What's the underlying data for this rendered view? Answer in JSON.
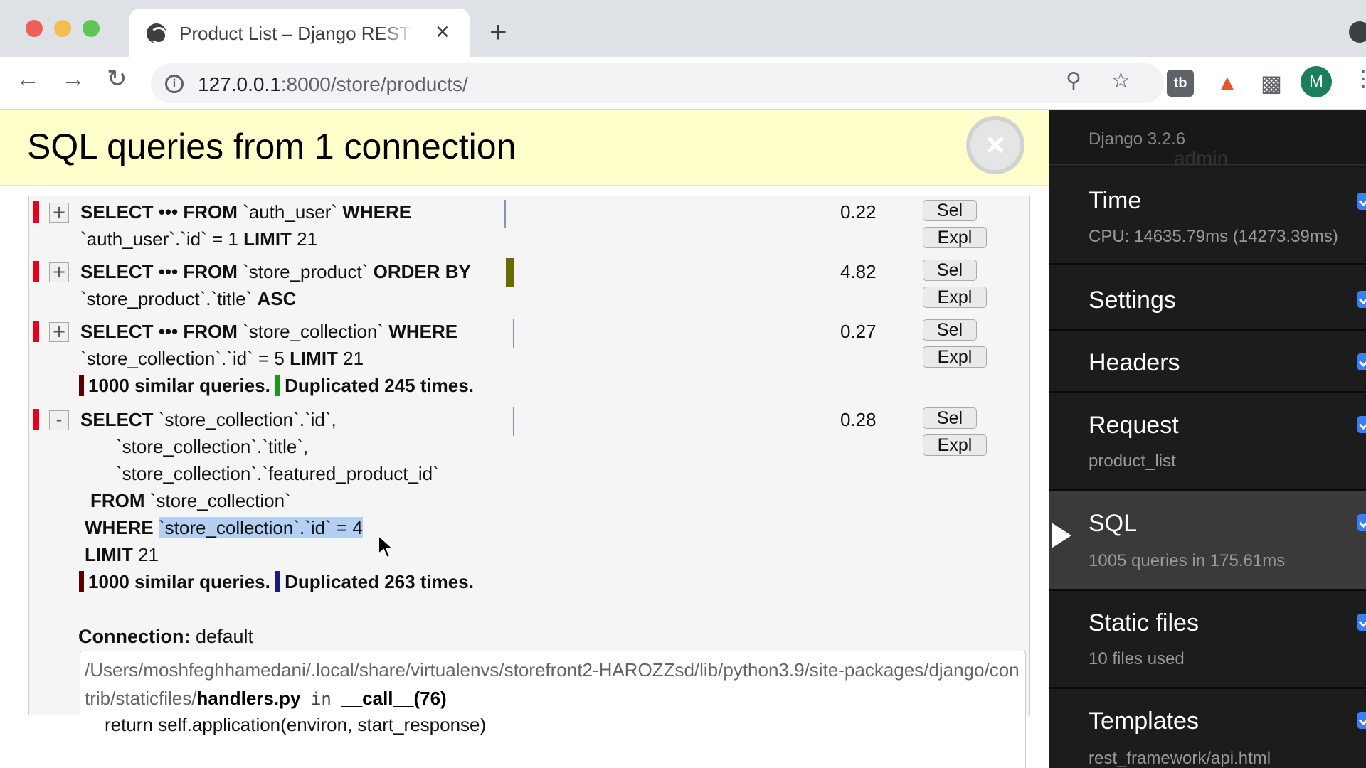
{
  "browser": {
    "tab_title": "Product List – Django REST framework",
    "tab_close": "×",
    "new_tab": "+",
    "url_host": "127.0.0.1",
    "url_rest": ":8000/store/products/",
    "avatar_letter": "M",
    "ext_tb_label": "tb"
  },
  "panel": {
    "title": "SQL queries from 1 connection",
    "close_label": "×"
  },
  "queries": [
    {
      "toggle": "+",
      "line1_kw1": "SELECT ••• FROM",
      "line1_t1": " `auth_user` ",
      "line1_kw2": "WHERE",
      "line2_t1": "`auth_user`.`id` = 1 ",
      "line2_kw": "LIMIT",
      "line2_t2": " 21",
      "time": "0.22"
    },
    {
      "toggle": "+",
      "line1_kw1": "SELECT ••• FROM",
      "line1_t1": " `store_product` ",
      "line1_kw2": "ORDER BY",
      "line2_t1": "`store_product`.`title` ",
      "line2_kw": "ASC",
      "line2_t2": "",
      "time": "4.82"
    },
    {
      "toggle": "+",
      "line1_kw1": "SELECT ••• FROM",
      "line1_t1": " `store_collection` ",
      "line1_kw2": "WHERE",
      "line2_t1": "`store_collection`.`id` = 5 ",
      "line2_kw": "LIMIT",
      "line2_t2": " 21",
      "similar": "1000 similar queries.",
      "duplicated": "Duplicated 245 times.",
      "time": "0.27"
    },
    {
      "toggle": "-",
      "kw_select": "SELECT",
      "col1": " `store_collection`.`id`,",
      "col2": "`store_collection`.`title`,",
      "col3": "`store_collection`.`featured_product_id`",
      "kw_from": "FROM",
      "from_table": " `store_collection`",
      "kw_where": "WHERE",
      "where_expr": "`store_collection`.`id` = 4",
      "kw_limit": "LIMIT",
      "limit_val": " 21",
      "similar": "1000 similar queries.",
      "duplicated": "Duplicated 263 times.",
      "time": "0.28"
    }
  ],
  "buttons": {
    "sel": "Sel",
    "expl": "Expl"
  },
  "connection": {
    "label": "Connection:",
    "value": " default",
    "trace_path": "/Users/moshfeghhamedani/.local/share/virtualenvs/storefront2-HAROZZsd/lib/python3.9/site-packages/django/contrib/staticfiles/",
    "trace_file": "handlers.py",
    "trace_in": " in ",
    "trace_func": "__call__",
    "trace_line": "(76)",
    "trace_code": "return self.application(environ, start_response)"
  },
  "sidebar": {
    "version": "Django 3.2.6",
    "admin_peek": "admin",
    "items": [
      {
        "label": "Time",
        "sub": "CPU: 14635.79ms (14273.39ms)"
      },
      {
        "label": "Settings",
        "sub": ""
      },
      {
        "label": "Headers",
        "sub": ""
      },
      {
        "label": "Request",
        "sub": "product_list"
      },
      {
        "label": "SQL",
        "sub": "1005 queries in 175.61ms"
      },
      {
        "label": "Static files",
        "sub": "10 files used"
      },
      {
        "label": "Templates",
        "sub": "rest_framework/api.html"
      }
    ]
  },
  "colors": {
    "header_bg": "#ffffcc",
    "marker_red": "#e8001c",
    "similar_bar": "#5a0000",
    "dup_bar_green": "#1a9a1a",
    "dup_bar_navy": "#1a1a80",
    "sidebar_bg": "#111111",
    "checkbox": "#3a7ef5"
  }
}
